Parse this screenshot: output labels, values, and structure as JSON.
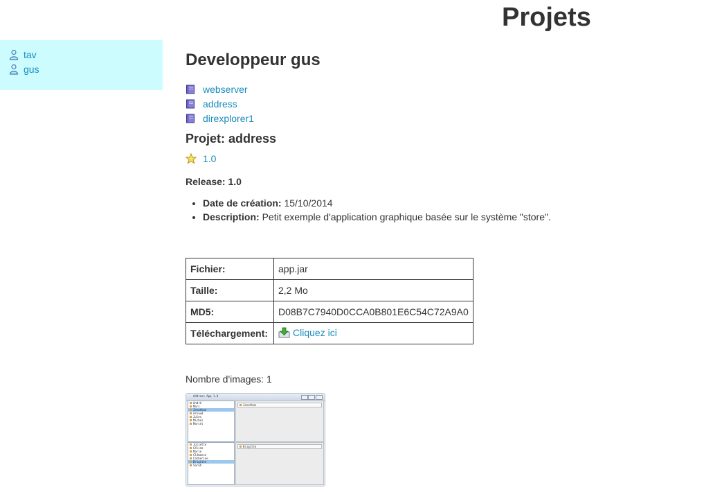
{
  "page": {
    "title": "Projets"
  },
  "sidebar": {
    "developers": [
      {
        "name": "tav",
        "icon": "user-icon"
      },
      {
        "name": "gus",
        "icon": "user-icon"
      }
    ]
  },
  "developer": {
    "title": "Developpeur gus",
    "projects": [
      {
        "name": "webserver",
        "icon": "book-icon"
      },
      {
        "name": "address",
        "icon": "book-icon"
      },
      {
        "name": "direxplorer1",
        "icon": "book-icon"
      }
    ]
  },
  "project": {
    "title": "Projet: address",
    "releases": [
      {
        "version": "1.0",
        "icon": "star-icon"
      }
    ]
  },
  "release": {
    "title": "Release: 1.0",
    "details": [
      {
        "label": "Date de création:",
        "value": "15/10/2014"
      },
      {
        "label": "Description:",
        "value": "Petit exemple d'application graphique basée sur le système \"store\"."
      }
    ]
  },
  "file_table": {
    "rows": [
      {
        "key": "Fichier:",
        "value": "app.jar"
      },
      {
        "key": "Taille:",
        "value": "2,2 Mo"
      },
      {
        "key": "MD5:",
        "value": "D08B7C7940D0CCA0B801E6C54C72A9A0"
      },
      {
        "key": "Téléchargement:",
        "value": "Cliquez ici",
        "icon": "download-icon"
      }
    ]
  },
  "images": {
    "count_text": "Nombre d'images: 1",
    "thumbnail": {
      "window_title": "Address App 1.0",
      "list_top": [
        "André",
        "Marc",
        "Jonathan",
        "Arnaud",
        "Jules",
        "Michel",
        "Marcel"
      ],
      "list_top_selected": "Jonathan",
      "header_top": "Jonathan",
      "list_bottom": [
        "Juliette",
        "Céline",
        "Marie",
        "Clémence",
        "Catherine",
        "Brigitte",
        "Sarah"
      ],
      "list_bottom_selected": "Brigitte",
      "header_bottom": "Brigitte"
    }
  },
  "colors": {
    "link": "#1a8bbd",
    "sidebar_bg": "#ccfcfe",
    "text": "#333333"
  }
}
